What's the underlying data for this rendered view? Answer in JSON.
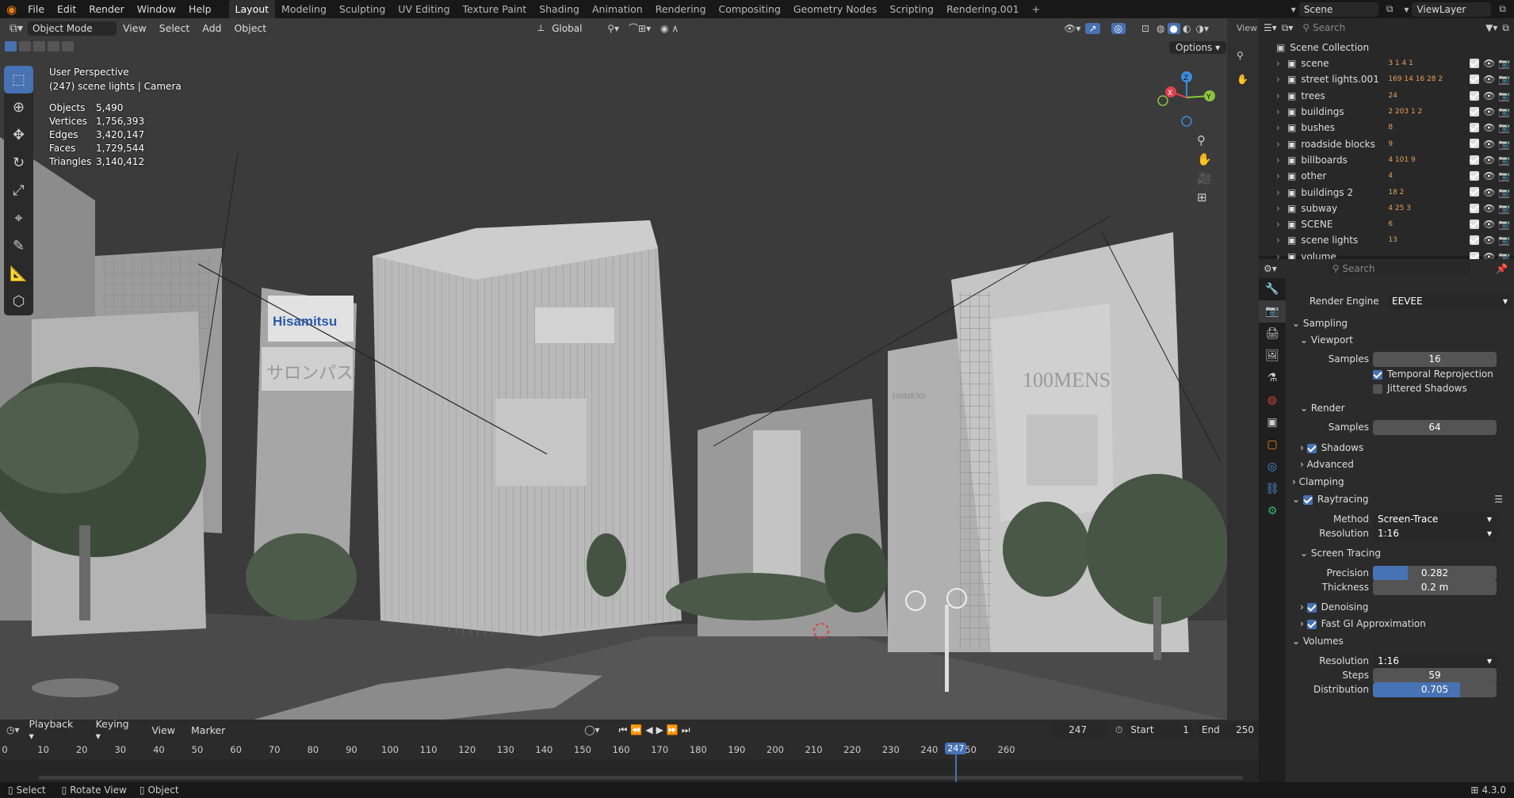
{
  "topbar": {
    "menus": [
      "File",
      "Edit",
      "Render",
      "Window",
      "Help"
    ],
    "workspaces": [
      "Layout",
      "Modeling",
      "Sculpting",
      "UV Editing",
      "Texture Paint",
      "Shading",
      "Animation",
      "Rendering",
      "Compositing",
      "Geometry Nodes",
      "Scripting",
      "Rendering.001"
    ],
    "active_workspace": "Layout",
    "add_tab": "+",
    "scene_name": "Scene",
    "view_layer": "ViewLayer"
  },
  "viewport": {
    "mode": "Object Mode",
    "menus": [
      "View",
      "Select",
      "Add",
      "Object"
    ],
    "transform_orientation": "Global",
    "options_label": "Options",
    "overlay_title": "User Perspective",
    "overlay_subtitle": "(247) scene lights | Camera",
    "stats": [
      {
        "label": "Objects",
        "value": "5,490"
      },
      {
        "label": "Vertices",
        "value": "1,756,393"
      },
      {
        "label": "Edges",
        "value": "3,420,147"
      },
      {
        "label": "Faces",
        "value": "1,729,544"
      },
      {
        "label": "Triangles",
        "value": "3,140,412"
      }
    ],
    "gizmo_axes": [
      "X",
      "Y",
      "Z"
    ],
    "sign_hisamitsu": "Hisamitsu",
    "sign_jp": "サロンパス",
    "sign_100mens": "100MENS",
    "sign_100mens_small": "100MENS",
    "colors": {
      "bg": "#3b3b3b",
      "accent": "#4772b3",
      "x_axis": "#e0414f",
      "y_axis": "#8bc53f",
      "z_axis": "#3d8bd9"
    }
  },
  "outliner": {
    "search_placeholder": "Search",
    "root": "Scene Collection",
    "items": [
      {
        "name": "scene",
        "badges": "3 1 4 1"
      },
      {
        "name": "street lights.001",
        "badges": "169 14 16 28 2"
      },
      {
        "name": "trees",
        "badges": "24"
      },
      {
        "name": "buildings",
        "badges": "2 203 1 2"
      },
      {
        "name": "bushes",
        "badges": "8"
      },
      {
        "name": "roadside blocks",
        "badges": "9"
      },
      {
        "name": "billboards",
        "badges": "4 101 9"
      },
      {
        "name": "other",
        "badges": "4"
      },
      {
        "name": "buildings 2",
        "badges": "18 2"
      },
      {
        "name": "subway",
        "badges": "4 25 3"
      },
      {
        "name": "SCENE",
        "badges": "6"
      },
      {
        "name": "scene lights",
        "badges": "13"
      },
      {
        "name": "volume",
        "badges": ""
      }
    ]
  },
  "properties": {
    "search_placeholder": "Search",
    "render_engine_label": "Render Engine",
    "render_engine": "EEVEE",
    "sampling": "Sampling",
    "viewport_sub": "Viewport",
    "samples_label": "Samples",
    "viewport_samples": "16",
    "temporal_reprojection": "Temporal Reprojection",
    "jittered_shadows": "Jittered Shadows",
    "render_sub": "Render",
    "render_samples": "64",
    "shadows": "Shadows",
    "advanced": "Advanced",
    "clamping": "Clamping",
    "raytracing": "Raytracing",
    "method_label": "Method",
    "method": "Screen-Trace",
    "resolution_label": "Resolution",
    "resolution": "1:16",
    "screen_tracing": "Screen Tracing",
    "precision_label": "Precision",
    "precision": "0.282",
    "precision_fraction": 0.282,
    "thickness_label": "Thickness",
    "thickness": "0.2 m",
    "denoising": "Denoising",
    "fast_gi": "Fast GI Approximation",
    "volumes": "Volumes",
    "vol_resolution": "1:16",
    "steps_label": "Steps",
    "steps": "59",
    "distribution_label": "Distribution",
    "distribution": "0.705",
    "distribution_fraction": 0.705
  },
  "timeline": {
    "menus": [
      "Playback",
      "Keying",
      "View",
      "Marker"
    ],
    "current_frame": "247",
    "start_label": "Start",
    "start": "1",
    "end_label": "End",
    "end": "250",
    "ticks": [
      "0",
      "10",
      "20",
      "30",
      "40",
      "50",
      "60",
      "70",
      "80",
      "90",
      "100",
      "110",
      "120",
      "130",
      "140",
      "150",
      "160",
      "170",
      "180",
      "190",
      "200",
      "210",
      "220",
      "230",
      "240",
      "250",
      "260"
    ],
    "playhead_label": "247"
  },
  "statusbar": {
    "select": "Select",
    "rotate": "Rotate View",
    "object": "Object",
    "version": "4.3.0"
  }
}
